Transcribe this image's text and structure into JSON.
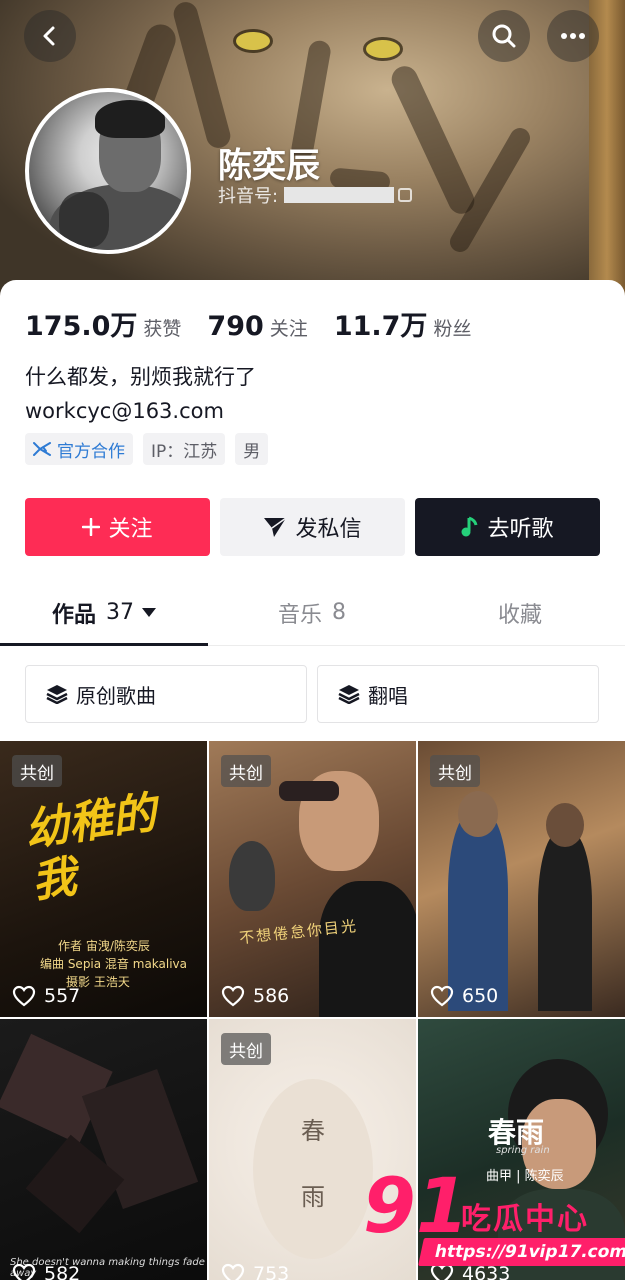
{
  "profile": {
    "name": "陈奕辰",
    "douyin_id_label": "抖音号:",
    "bio": "什么都发，别烦我就行了",
    "email": "workcyc@163.com"
  },
  "stats": [
    {
      "value": "175.0万",
      "label": "获赞"
    },
    {
      "value": "790",
      "label": "关注"
    },
    {
      "value": "11.7万",
      "label": "粉丝"
    }
  ],
  "tags": {
    "official": "官方合作",
    "ip": "IP：江苏",
    "gender": "男"
  },
  "actions": {
    "follow": "关注",
    "message": "发私信",
    "listen": "去听歌"
  },
  "tabs": [
    {
      "label": "作品",
      "count": "37"
    },
    {
      "label": "音乐",
      "count": "8"
    },
    {
      "label": "收藏",
      "count": ""
    }
  ],
  "filters": [
    "原创歌曲",
    "翻唱"
  ],
  "videos": [
    {
      "badge": "共创",
      "likes": "557",
      "title": "幼稚的我",
      "credits": [
        "作者  宙洩/陈奕辰",
        "编曲  Sepia  混音  makaliva",
        "摄影  王浩天"
      ]
    },
    {
      "badge": "共创",
      "likes": "586",
      "lyric": "不想倦怠你目光"
    },
    {
      "badge": "共创",
      "likes": "650"
    },
    {
      "badge": "",
      "likes": "582",
      "caption": "She doesn't wanna making things fade away"
    },
    {
      "badge": "共创",
      "likes": "753",
      "chars": [
        "春",
        "雨"
      ]
    },
    {
      "badge": "",
      "likes": "4633",
      "title": "春雨",
      "subtitle": "spring rain",
      "credit": "曲甲 | 陈奕辰"
    }
  ],
  "watermark": {
    "number": "91",
    "text": "吃瓜中心",
    "url": "https://91vip17.com"
  },
  "colors": {
    "follow": "#fe2c55",
    "listen": "#161823",
    "watermark": "#ff1f6a"
  }
}
